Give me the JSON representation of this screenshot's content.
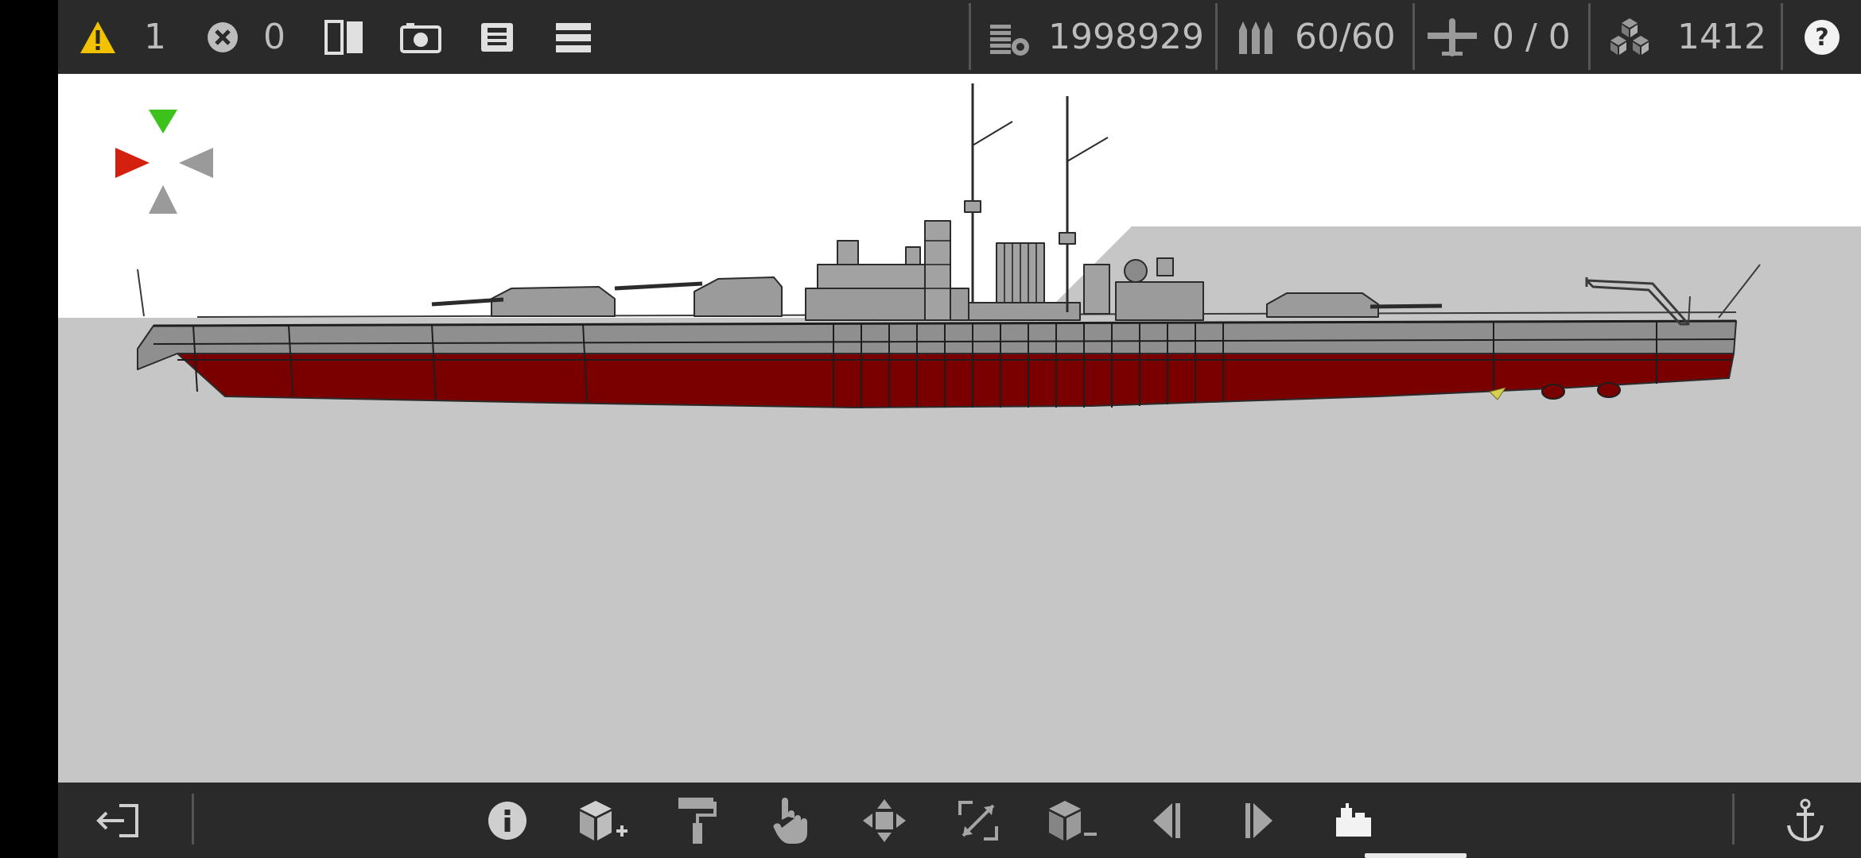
{
  "top_bar": {
    "warnings": {
      "icon": "warning-icon",
      "count": "1",
      "color": "#f2c200"
    },
    "errors": {
      "icon": "error-icon",
      "count": "0"
    },
    "mirror_icon": "mirror-icon",
    "screenshot_icon": "camera-icon",
    "save_icon": "save-icon",
    "menu_icon": "menu-icon",
    "cost": {
      "icon": "coins-icon",
      "value": "1998929"
    },
    "ammo": {
      "icon": "ammo-icon",
      "value": "60/60"
    },
    "aircraft": {
      "icon": "aircraft-icon",
      "value": "0 / 0"
    },
    "parts": {
      "icon": "parts-icon",
      "value": "1412"
    },
    "help_icon": "help-icon"
  },
  "gizmo": {
    "up_color": "#3dc11b",
    "left_color": "#d3200f",
    "neutral_color": "#9a9a9a"
  },
  "ship": {
    "hull_color": "#8f8f8f",
    "below_waterline_color": "#7a0000"
  },
  "bottom_bar": {
    "tools": [
      "exit-icon",
      "info-icon",
      "add-block-icon",
      "paint-roller-icon",
      "hand-icon",
      "move-icon",
      "resize-icon",
      "remove-block-icon",
      "previous-icon",
      "next-icon",
      "build-mode-icon",
      "anchor-icon"
    ],
    "active_tool": "build-mode-icon"
  }
}
